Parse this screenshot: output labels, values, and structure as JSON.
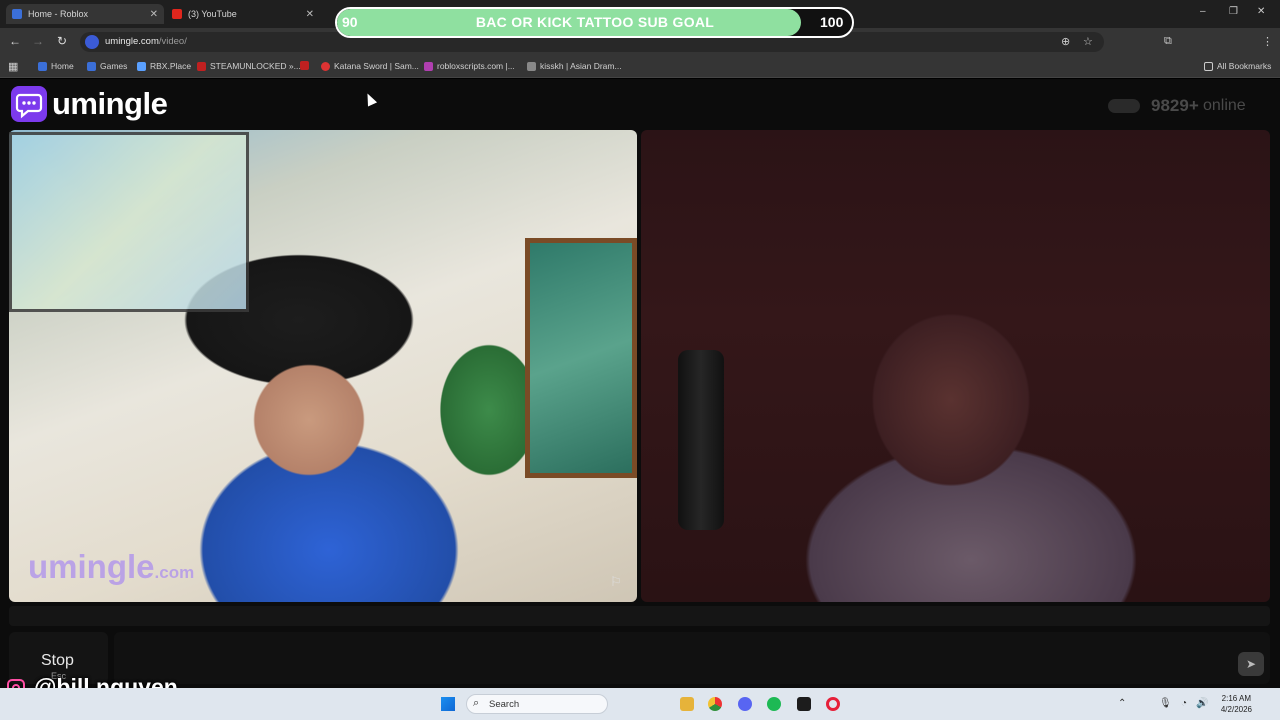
{
  "tabs": [
    {
      "title": "Home - Roblox",
      "color": "#3b6fd8"
    },
    {
      "title": "(3) YouTube",
      "color": "#e0261d"
    }
  ],
  "window_controls": {
    "minimize": "–",
    "maximize": "❐",
    "close": "✕"
  },
  "toolbar": {
    "back": "←",
    "forward": "→",
    "reload": "↻"
  },
  "address_bar": {
    "host": "umingle.com",
    "path": "/video/"
  },
  "toolbar_icons": {
    "zoom": "⊕",
    "star": "☆",
    "extensions": "⧉",
    "menu": "⋮"
  },
  "bookmarks": {
    "apps_icon": "▦",
    "items": [
      {
        "label": "Home",
        "color": "#3b6fd8"
      },
      {
        "label": "Games",
        "color": "#3b6fd8"
      },
      {
        "label": "RBX.Place",
        "color": "#5aa0ff"
      },
      {
        "label": "STEAMUNLOCKED »...",
        "color": "#c02020"
      },
      {
        "label": "",
        "color": "#c02020"
      },
      {
        "label": "Katana Sword | Sam...",
        "color": "#d33"
      },
      {
        "label": "robloxscripts.com |...",
        "color": "#b03fb0"
      },
      {
        "label": "kisskh | Asian Dram...",
        "color": "#888"
      }
    ],
    "all_bookmarks": "All Bookmarks"
  },
  "goal_overlay": {
    "start": "90",
    "title": "BAC OR KICK TATTOO SUB GOAL",
    "end": "100",
    "progress": 0.9,
    "fill_color": "#8fe0a0"
  },
  "site": {
    "logo_text": "umingle",
    "brand_color": "#7c3aed",
    "online_count": "9829+",
    "online_label": "online",
    "watermark": "umingle",
    "watermark_suffix": ".com",
    "report_icon": "⚐"
  },
  "controls": {
    "stop_label": "Stop",
    "stop_hint": "Esc",
    "send_icon": "➤"
  },
  "streamer": {
    "handle": "@bill.nguyen"
  },
  "taskbar": {
    "search_label": "Search",
    "search_icon": "⌕",
    "apps": [
      {
        "name": "file-explorer",
        "color": "#e6b33a"
      },
      {
        "name": "chrome",
        "color": "#2f8f3a"
      },
      {
        "name": "discord",
        "color": "#5865f2"
      },
      {
        "name": "spotify",
        "color": "#1db954"
      },
      {
        "name": "android-studio",
        "color": "#1c1c1c"
      },
      {
        "name": "opera",
        "color": "#e62039"
      }
    ],
    "tray": {
      "chevron": "⌃",
      "mic": "🎙",
      "wifi": "◔",
      "volume": "🔊",
      "battery": "▭"
    },
    "time": "2:16 AM",
    "date": "4/2/2026"
  }
}
